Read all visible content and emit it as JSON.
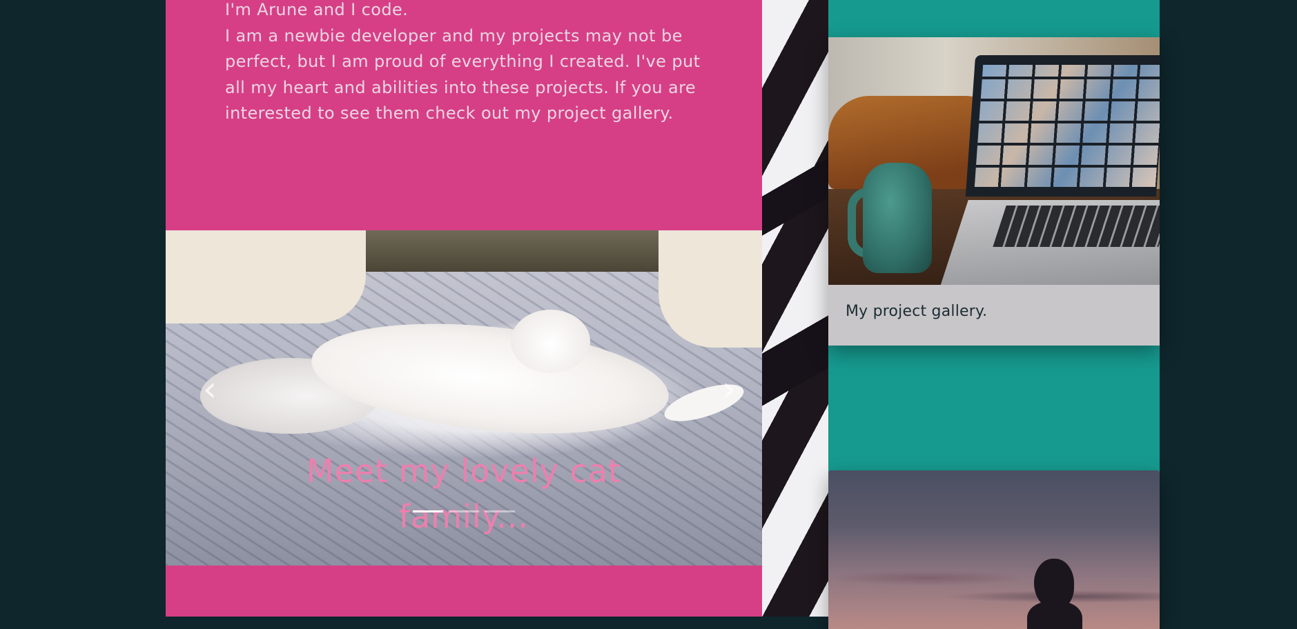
{
  "intro": {
    "heading": "I'm Arune and I code.",
    "body": "I am a newbie developer and my projects may not be perfect, but I am proud of everything I created. I've put all my heart and abilities into these projects. If you are interested to see them check out my project gallery."
  },
  "carousel": {
    "caption": "Meet my lovely cat family...",
    "prev_icon": "chevron-left",
    "next_icon": "chevron-right",
    "prev_glyph": "‹",
    "next_glyph": "›",
    "slides_count": 3,
    "active_slide": 1
  },
  "cards": [
    {
      "text": "My project gallery.",
      "image": "coffee-mug-laptop-video-call-photo"
    },
    {
      "text": "",
      "image": "sunset-silhouette-photo"
    }
  ],
  "colors": {
    "page_bg": "#0e262c",
    "left_panel": "#d63f86",
    "right_panel": "#169a8f",
    "caption": "#ee7fae",
    "card_bg": "#c9c6c9"
  }
}
